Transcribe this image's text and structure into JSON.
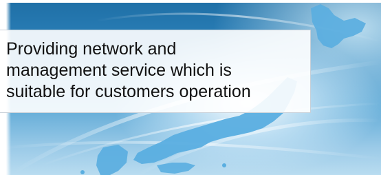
{
  "banner": {
    "lines": [
      "Providing network and",
      "management service which is",
      "suitable for customers operation"
    ]
  },
  "decor": {
    "background": "map-of-japan-with-network-light-trails",
    "map_color": "#5aaee0",
    "text_panel_color": "#ffffff"
  }
}
